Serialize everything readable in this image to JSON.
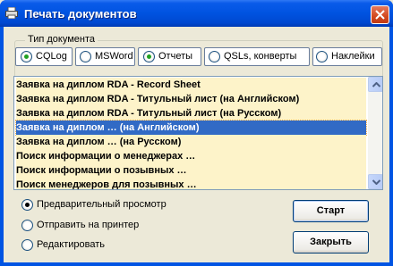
{
  "window": {
    "title": "Печать документов",
    "icon": "printer-icon"
  },
  "doc_type_group": {
    "title": "Тип документа",
    "options": [
      {
        "label": "CQLog",
        "checked": true
      },
      {
        "label": "MSWord",
        "checked": false
      },
      {
        "label": "Отчеты",
        "checked": true
      },
      {
        "label": "QSLs, конверты",
        "checked": false
      },
      {
        "label": "Наклейки",
        "checked": false
      }
    ]
  },
  "documents": {
    "items": [
      "Заявка на диплом RDA - Record Sheet",
      "Заявка на диплом RDA - Титульный лист (на Английском)",
      "Заявка на диплом RDA - Титульный лист (на Русском)",
      "Заявка на диплом … (на Английском)",
      "Заявка на диплом … (на Русском)",
      "Поиск информации о менеджерах …",
      "Поиск информации о позывных …",
      "Поиск менеджеров для позывных …"
    ],
    "selected_index": 3
  },
  "output_options": [
    {
      "label": "Предварительный просмотр",
      "checked": true
    },
    {
      "label": "Отправить на принтер",
      "checked": false
    },
    {
      "label": "Редактировать",
      "checked": false
    }
  ],
  "buttons": {
    "start": "Старт",
    "close": "Закрыть"
  },
  "colors": {
    "titlebar": "#0054e3",
    "list_bg": "#fdf3c9",
    "selection": "#316ac5",
    "face": "#ece9d8"
  }
}
